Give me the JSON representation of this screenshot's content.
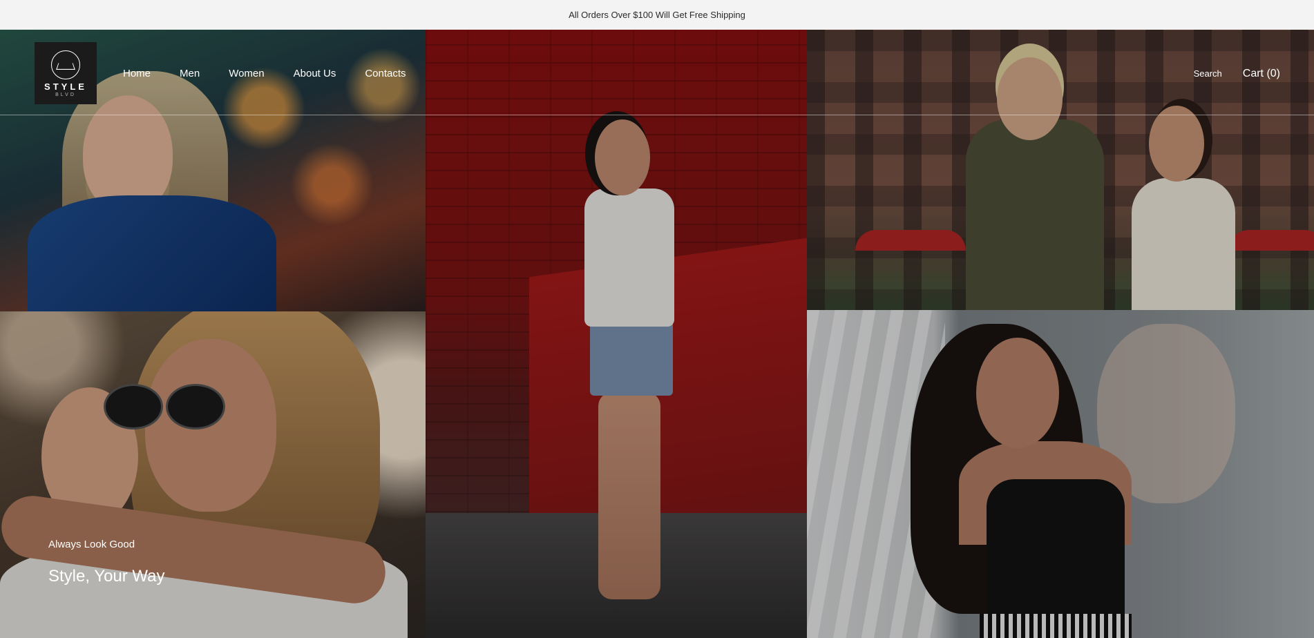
{
  "announcement": "All Orders Over $100 Will Get Free Shipping",
  "logo": {
    "name": "STYLE",
    "sub": "BLVD"
  },
  "nav": {
    "items": [
      {
        "label": "Home"
      },
      {
        "label": "Men"
      },
      {
        "label": "Women"
      },
      {
        "label": "About Us"
      },
      {
        "label": "Contacts"
      }
    ]
  },
  "utilities": {
    "search_label": "Search",
    "cart_label": "Cart (0)"
  },
  "hero": {
    "kicker": "Always Look Good",
    "headline": "Style, Your Way"
  },
  "colors": {
    "logo_bg": "#1b1b1b",
    "announcement_bg": "#f3f3f3",
    "text_light": "#ffffff"
  }
}
